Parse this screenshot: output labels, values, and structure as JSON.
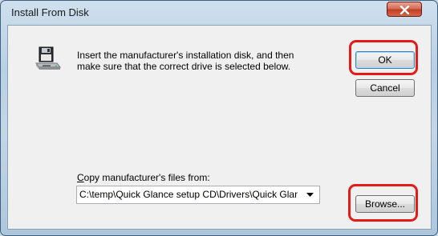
{
  "dialog": {
    "title": "Install From Disk",
    "instructions_line1": "Insert the manufacturer's installation disk, and then",
    "instructions_line2": "make sure that the correct drive is selected below."
  },
  "buttons": {
    "ok": "OK",
    "cancel": "Cancel",
    "browse": "Browse..."
  },
  "copy_from": {
    "label_prefix": "C",
    "label_rest": "opy manufacturer's files from:",
    "path": "C:\\temp\\Quick Glance setup CD\\Drivers\\Quick Glance"
  },
  "icons": [
    "floppy-drive-icon",
    "close-icon",
    "dropdown-arrow-icon"
  ],
  "colors": {
    "highlight": "#e41b17",
    "close_button": "#c03c22"
  }
}
